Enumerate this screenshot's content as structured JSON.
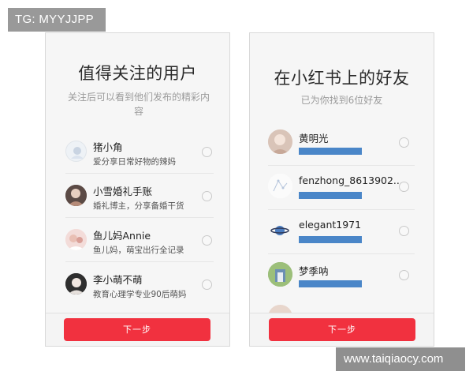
{
  "watermarks": {
    "top_left": "TG: MYYJJPP",
    "bottom_right": "www.taiqiaocy.com"
  },
  "left_screen": {
    "title": "值得关注的用户",
    "subtitle": "关注后可以看到他们发布的精彩内容",
    "users": [
      {
        "name": "猪小角",
        "desc": "爱分享日常好物的辣妈"
      },
      {
        "name": "小雪婚礼手账",
        "desc": "婚礼博主，分享备婚干货"
      },
      {
        "name": "鱼儿妈Annie",
        "desc": "鱼儿妈，萌宝出行全记录"
      },
      {
        "name": "李小萌不萌",
        "desc": "教育心理学专业90后萌妈"
      }
    ],
    "next_button": "下一步"
  },
  "right_screen": {
    "title": "在小红书上的好友",
    "subtitle": "已为你找到6位好友",
    "friends": [
      {
        "name": "黄明光"
      },
      {
        "name": "fenzhong_8613902..."
      },
      {
        "name": "elegant1971"
      },
      {
        "name": "梦季呐"
      }
    ],
    "next_button": "下一步"
  },
  "colors": {
    "accent": "#f1313f",
    "redaction_bar": "#4a86c8"
  }
}
